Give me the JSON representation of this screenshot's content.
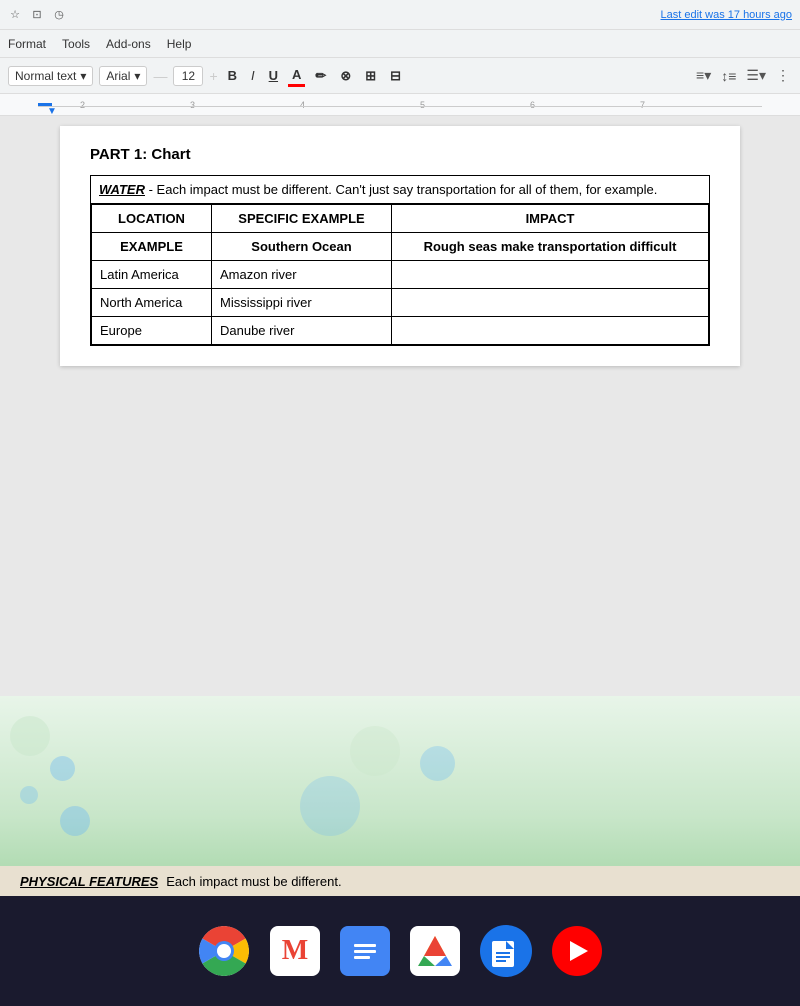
{
  "topChrome": {
    "icons": [
      "star",
      "clipboard",
      "history"
    ],
    "lastEdit": "Last edit was 17 hours ago"
  },
  "menuBar": {
    "items": [
      "Format",
      "Tools",
      "Add-ons",
      "Help"
    ]
  },
  "toolbar": {
    "textStyle": "Normal text",
    "font": "Arial",
    "minus": "−",
    "fontSize": "12",
    "plus": "+",
    "bold": "B",
    "italic": "I",
    "underline": "U",
    "colorA": "A",
    "link": "🔗",
    "comment": "💬",
    "image": "🖼",
    "alignMenu": "≡",
    "lineSpacing": "↕",
    "listMenu": "☰",
    "more": "⋮"
  },
  "ruler": {
    "marks": [
      "2",
      "3",
      "4",
      "5",
      "6",
      "7"
    ]
  },
  "document": {
    "partTitle": "PART 1: Chart",
    "waterLabel": "WATER",
    "waterNote": "- Each impact must be different.  Can't just say transportation for all of them, for example.",
    "tableHeaders": {
      "location": "LOCATION",
      "specificExample": "SPECIFIC EXAMPLE",
      "impact": "IMPACT"
    },
    "exampleRow": {
      "location": "EXAMPLE",
      "specificExample": "Southern Ocean",
      "impact": "Rough seas make transportation difficult"
    },
    "dataRows": [
      {
        "location": "Latin America",
        "specificExample": "Amazon river",
        "impact": ""
      },
      {
        "location": "North America",
        "specificExample": "Mississippi river",
        "impact": ""
      },
      {
        "location": "Europe",
        "specificExample": "Danube river",
        "impact": ""
      }
    ]
  },
  "bottomSection": {
    "label": "PHYSICAL FEATURES",
    "note": "Each impact must be different."
  },
  "taskbar": {
    "apps": [
      {
        "name": "Chrome",
        "type": "chrome"
      },
      {
        "name": "Gmail",
        "type": "gmail"
      },
      {
        "name": "Docs",
        "type": "docs"
      },
      {
        "name": "Drive",
        "type": "drive"
      },
      {
        "name": "Files",
        "type": "files"
      },
      {
        "name": "YouTube",
        "type": "youtube"
      }
    ]
  }
}
